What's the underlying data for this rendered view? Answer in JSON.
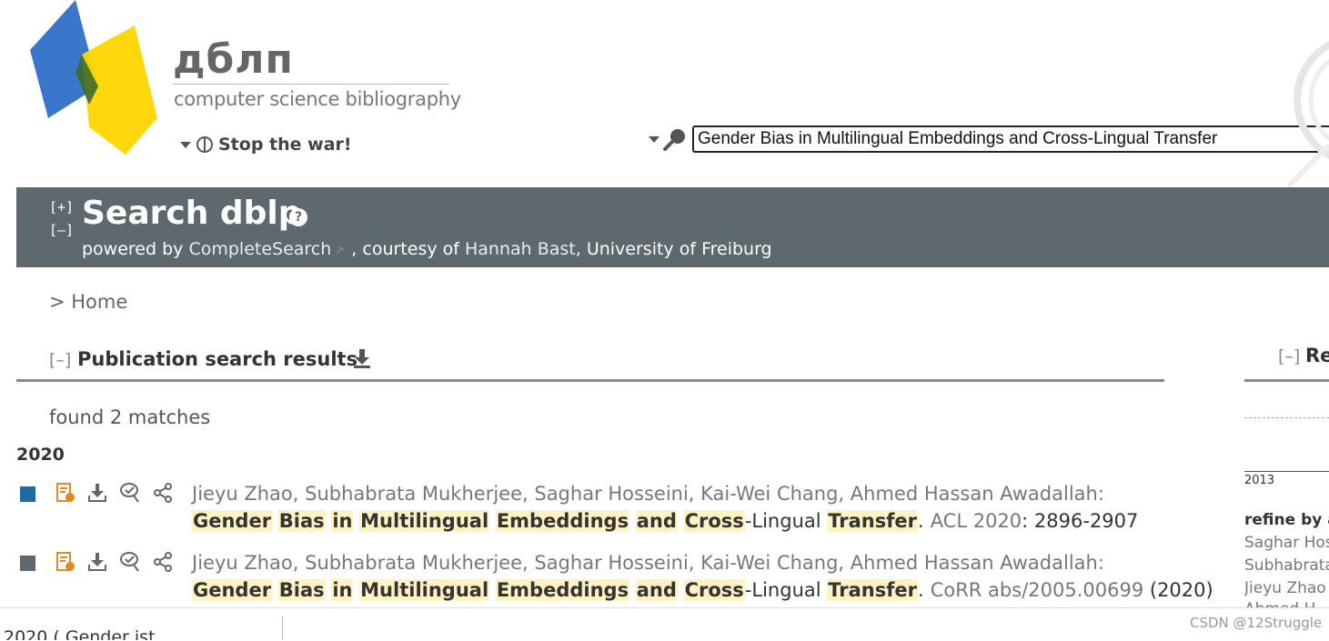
{
  "header": {
    "wordmark": "дблп",
    "subtitle": "computer science bibliography",
    "stop_war": "Stop the war!",
    "search_value": "Gender Bias in Multilingual Embeddings and Cross-Lingual Transfer"
  },
  "banner": {
    "expand": "[+]",
    "collapse": "[–]",
    "title": "Search dblp",
    "help": "?",
    "powered_prefix": "powered by ",
    "powered_link": "CompleteSearch",
    "courtesy": ", courtesy of ",
    "person": "Hannah Bast",
    "affiliation": ", University of Freiburg"
  },
  "breadcrumb": "> Home",
  "results": {
    "toggle": "[–]",
    "heading": "Publication search results",
    "found": "found 2 matches",
    "year": "2020",
    "entries": [
      {
        "marker_color": "#1d6aa5",
        "authors": "Jieyu Zhao, Subhabrata Mukherjee, Saghar Hosseini, Kai-Wei Chang, Ahmed Hassan Awadallah:",
        "venue": "ACL 2020",
        "pages": ": 2896-2907"
      },
      {
        "marker_color": "#5d686f",
        "authors": "Jieyu Zhao, Subhabrata Mukherjee, Saghar Hosseini, Kai-Wei Chang, Ahmed Hassan Awadallah:",
        "venue": "CoRR abs/2005.00699",
        "pages": " (2020)"
      }
    ],
    "title_words": [
      {
        "t": "Gender",
        "h": true
      },
      {
        "t": " ",
        "h": false
      },
      {
        "t": "Bias",
        "h": true
      },
      {
        "t": " ",
        "h": false
      },
      {
        "t": "in",
        "h": true
      },
      {
        "t": " ",
        "h": false
      },
      {
        "t": "Multilingual",
        "h": true
      },
      {
        "t": " ",
        "h": false
      },
      {
        "t": "Embeddings",
        "h": true
      },
      {
        "t": " ",
        "h": false
      },
      {
        "t": "and",
        "h": true
      },
      {
        "t": " ",
        "h": false
      },
      {
        "t": "Cross",
        "h": true
      },
      {
        "t": "-Lingual ",
        "h": false
      },
      {
        "t": "Transfer",
        "h": true
      },
      {
        "t": ".",
        "h": false
      }
    ]
  },
  "sidebar": {
    "toggle": "[–]",
    "heading_partial": "Re",
    "year_tick": "2013",
    "refine": "refine by a",
    "names": [
      "Saghar Hos",
      "Subhabrata",
      "Jieyu Zhao",
      "Ahmed H"
    ]
  },
  "footer": {
    "text": "2020 ( Gender ist...",
    "watermark": "CSDN @12Struggle"
  },
  "colors": {
    "banner": "#5d686f",
    "highlight": "#fff3c4",
    "logo_blue": "#2f6fc7",
    "logo_yellow": "#ffd500"
  }
}
